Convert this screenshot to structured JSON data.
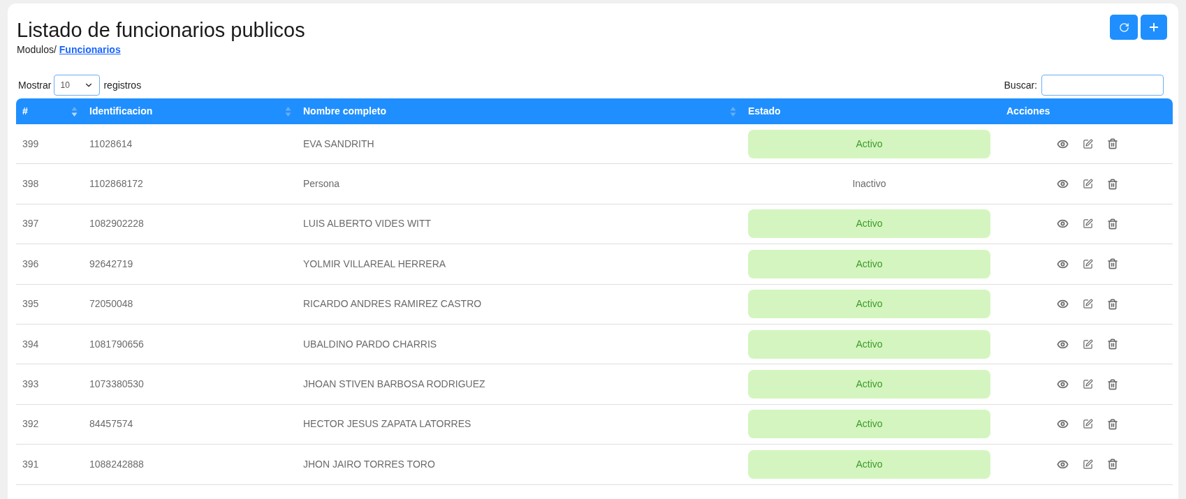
{
  "header": {
    "title": "Listado de funcionarios publicos",
    "breadcrumb": "Modulos/",
    "breadcrumb_link": "Funcionarios"
  },
  "length_control": {
    "prefix": "Mostrar",
    "value": "10",
    "suffix": "registros"
  },
  "search": {
    "label": "Buscar:"
  },
  "table": {
    "columns": [
      {
        "label": "#",
        "sortable": true,
        "sorted_desc": true
      },
      {
        "label": "Identificacion",
        "sortable": true,
        "sorted_desc": false
      },
      {
        "label": "Nombre completo",
        "sortable": true,
        "sorted_desc": false
      },
      {
        "label": "Estado",
        "sortable": false
      },
      {
        "label": "Acciones",
        "sortable": false
      }
    ],
    "rows": [
      {
        "id": "399",
        "identificacion": "11028614",
        "nombre": "EVA SANDRITH",
        "estado": "Activo",
        "active": true
      },
      {
        "id": "398",
        "identificacion": "1102868172",
        "nombre": "Persona",
        "estado": "Inactivo",
        "active": false
      },
      {
        "id": "397",
        "identificacion": "1082902228",
        "nombre": "LUIS ALBERTO VIDES WITT",
        "estado": "Activo",
        "active": true
      },
      {
        "id": "396",
        "identificacion": "92642719",
        "nombre": "YOLMIR VILLAREAL HERRERA",
        "estado": "Activo",
        "active": true
      },
      {
        "id": "395",
        "identificacion": "72050048",
        "nombre": "RICARDO ANDRES RAMIREZ CASTRO",
        "estado": "Activo",
        "active": true
      },
      {
        "id": "394",
        "identificacion": "1081790656",
        "nombre": "UBALDINO PARDO CHARRIS",
        "estado": "Activo",
        "active": true
      },
      {
        "id": "393",
        "identificacion": "1073380530",
        "nombre": "JHOAN STIVEN BARBOSA RODRIGUEZ",
        "estado": "Activo",
        "active": true
      },
      {
        "id": "392",
        "identificacion": "84457574",
        "nombre": "HECTOR JESUS ZAPATA LATORRES",
        "estado": "Activo",
        "active": true
      },
      {
        "id": "391",
        "identificacion": "1088242888",
        "nombre": "JHON JAIRO TORRES TORO",
        "estado": "Activo",
        "active": true
      }
    ]
  }
}
